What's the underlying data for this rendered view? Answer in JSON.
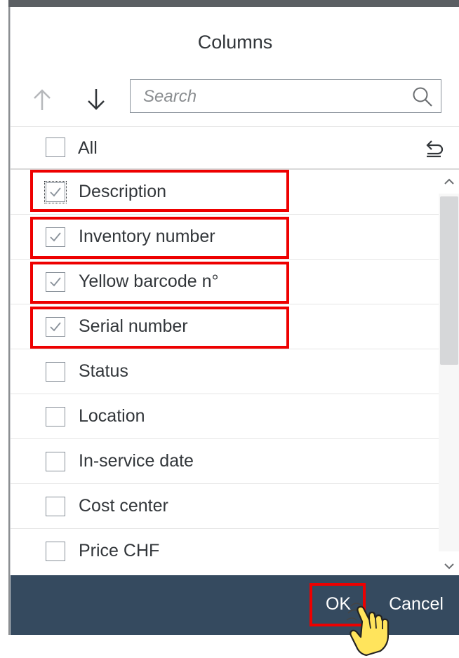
{
  "dialog": {
    "title": "Columns",
    "search": {
      "placeholder": "Search",
      "value": ""
    },
    "all_label": "All",
    "columns": [
      {
        "label": "Description",
        "checked": true,
        "highlighted": true
      },
      {
        "label": "Inventory number",
        "checked": true,
        "highlighted": true
      },
      {
        "label": "Yellow barcode n°",
        "checked": true,
        "highlighted": true
      },
      {
        "label": "Serial number",
        "checked": true,
        "highlighted": true
      },
      {
        "label": "Status",
        "checked": false,
        "highlighted": false
      },
      {
        "label": "Location",
        "checked": false,
        "highlighted": false
      },
      {
        "label": "In-service date",
        "checked": false,
        "highlighted": false
      },
      {
        "label": "Cost center",
        "checked": false,
        "highlighted": false
      },
      {
        "label": "Price CHF",
        "checked": false,
        "highlighted": false
      }
    ],
    "footer": {
      "ok_label": "OK",
      "cancel_label": "Cancel"
    }
  },
  "colors": {
    "footer_bg": "#354a5f",
    "highlight": "#ee0000",
    "text": "#32363a",
    "checkbox_border": "#89919a"
  },
  "icons": [
    "arrow-up-icon",
    "arrow-down-icon",
    "search-icon",
    "undo-icon",
    "checkmark-icon",
    "pointer-hand-icon"
  ]
}
